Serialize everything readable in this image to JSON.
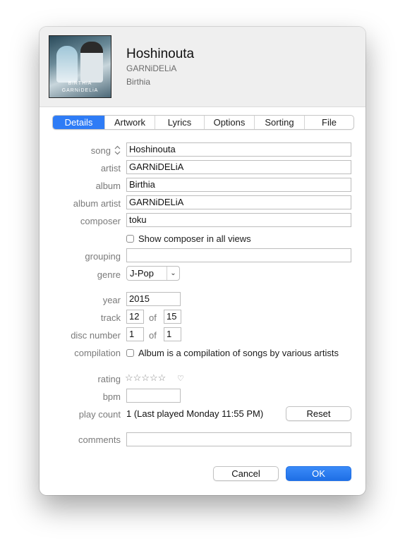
{
  "header": {
    "title": "Hoshinouta",
    "artist": "GARNiDELiA",
    "album": "Birthia",
    "artwork_text_line1": "BiRTHiA",
    "artwork_text_line2": "GARNiDELiA"
  },
  "tabs": [
    {
      "label": "Details",
      "active": true
    },
    {
      "label": "Artwork"
    },
    {
      "label": "Lyrics"
    },
    {
      "label": "Options"
    },
    {
      "label": "Sorting"
    },
    {
      "label": "File"
    }
  ],
  "form": {
    "song_label": "song",
    "song_value": "Hoshinouta",
    "artist_label": "artist",
    "artist_value": "GARNiDELiA",
    "album_label": "album",
    "album_value": "Birthia",
    "album_artist_label": "album artist",
    "album_artist_value": "GARNiDELiA",
    "composer_label": "composer",
    "composer_value": "toku",
    "show_composer_label": "Show composer in all views",
    "grouping_label": "grouping",
    "grouping_value": "",
    "genre_label": "genre",
    "genre_value": "J-Pop",
    "year_label": "year",
    "year_value": "2015",
    "track_label": "track",
    "track_value": "12",
    "track_total": "15",
    "of_label": "of",
    "disc_label": "disc number",
    "disc_value": "1",
    "disc_total": "1",
    "compilation_label": "compilation",
    "compilation_checkbox_label": "Album is a compilation of songs by various artists",
    "rating_label": "rating",
    "rating_stars": "☆☆☆☆☆",
    "rating_value": 0,
    "bpm_label": "bpm",
    "bpm_value": "",
    "play_count_label": "play count",
    "play_count_value": "1 (Last played Monday 11:55 PM)",
    "reset_label": "Reset",
    "comments_label": "comments",
    "comments_value": ""
  },
  "footer": {
    "cancel_label": "Cancel",
    "ok_label": "OK"
  },
  "colors": {
    "accent": "#2e7cf6",
    "label_gray": "#7a7a7a",
    "header_bg": "#efefef"
  }
}
